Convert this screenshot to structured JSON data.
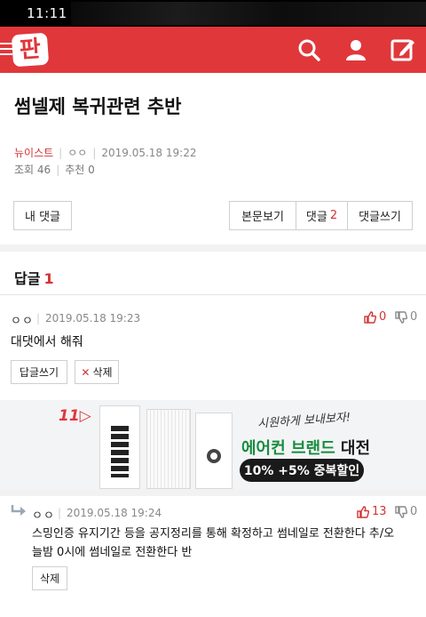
{
  "status_bar": {
    "time": "11:11"
  },
  "header": {
    "logo_text": "판",
    "icons": [
      "menu-icon",
      "search-icon",
      "user-icon",
      "write-icon"
    ]
  },
  "post": {
    "title": "썸넬제 복귀관련 추반",
    "category": "뉴이스트",
    "author": "ㅇㅇ",
    "datetime": "2019.05.18 19:22",
    "views_label": "조회",
    "views": "46",
    "recommend_label": "추천",
    "recommend": "0"
  },
  "buttons": {
    "my_comments": "내 댓글",
    "view_post": "본문보기",
    "comments": "댓글",
    "comments_count": "2",
    "write_comment": "댓글쓰기"
  },
  "replies_section": {
    "label": "답글",
    "count": "1"
  },
  "comments": [
    {
      "author": "ㅇㅇ",
      "datetime": "2019.05.18 19:23",
      "up": "0",
      "down": "0",
      "text": "대댓에서 해줘",
      "reply_button": "답글쓰기",
      "delete_button": "삭제"
    },
    {
      "author": "ㅇㅇ",
      "datetime": "2019.05.18 19:24",
      "up": "13",
      "down": "0",
      "text_line1": "스밍인증 유지기간 등을 공지정리를 통해 확정하고 썸네일로 전환한다 추/오",
      "text_line2": "늘밤 0시에 썸네일로 전환한다 반",
      "delete_button": "삭제"
    }
  ],
  "ad": {
    "brand": "11",
    "slogan": "시원하게 보내보자!",
    "heading_accent": "에어컨 브랜드",
    "heading_rest": "대전",
    "discount": "10% +5% 중복할인"
  },
  "colors": {
    "brand_red": "#e0373b",
    "accent_red": "#d23434",
    "ad_green": "#198c3e"
  }
}
